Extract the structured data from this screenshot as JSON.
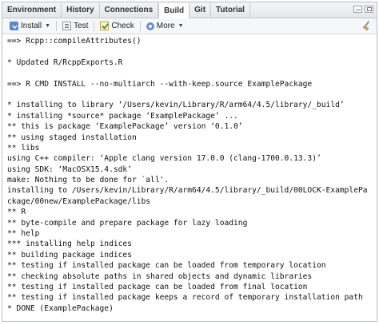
{
  "tabs": [
    "Environment",
    "History",
    "Connections",
    "Build",
    "Git",
    "Tutorial"
  ],
  "active_tab": "Build",
  "toolbar": {
    "install_label": "Install",
    "test_label": "Test",
    "check_label": "Check",
    "more_label": "More"
  },
  "console": {
    "lines": [
      "==> Rcpp::compileAttributes()",
      "",
      "* Updated R/RcppExports.R",
      "",
      "==> R CMD INSTALL --no-multiarch --with-keep.source ExamplePackage",
      "",
      "* installing to library ‘/Users/kevin/Library/R/arm64/4.5/library/_build’",
      "* installing *source* package ‘ExamplePackage’ ...",
      "** this is package ‘ExamplePackage’ version ‘0.1.0’",
      "** using staged installation",
      "** libs",
      "using C++ compiler: ‘Apple clang version 17.0.0 (clang-1700.0.13.3)’",
      "using SDK: ‘MacOSX15.4.sdk’",
      "make: Nothing to be done for `all'.",
      "installing to /Users/kevin/Library/R/arm64/4.5/library/_build/00LOCK-ExamplePa",
      "ckage/00new/ExamplePackage/libs",
      "** R",
      "** byte-compile and prepare package for lazy loading",
      "** help",
      "*** installing help indices",
      "** building package indices",
      "** testing if installed package can be loaded from temporary location",
      "** checking absolute paths in shared objects and dynamic libraries",
      "** testing if installed package can be loaded from final location",
      "** testing if installed package keeps a record of temporary installation path",
      "* DONE (ExamplePackage)"
    ]
  }
}
